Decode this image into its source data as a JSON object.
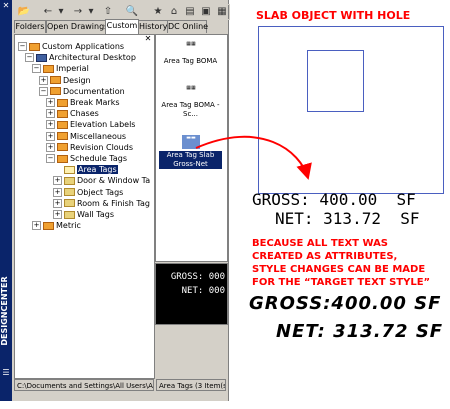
{
  "palette": {
    "title": "DESIGNCENTER",
    "close_glyph": "✕",
    "properties_glyph": "☰"
  },
  "tabs": [
    {
      "label": "Folders"
    },
    {
      "label": "Open Drawings"
    },
    {
      "label": "Custom"
    },
    {
      "label": "History"
    },
    {
      "label": "DC Online"
    }
  ],
  "tree": [
    {
      "label": "Custom Applications",
      "level": 0,
      "expander": "−",
      "icon": "orange"
    },
    {
      "label": "Architectural Desktop",
      "level": 1,
      "expander": "−",
      "icon": "blue"
    },
    {
      "label": "Imperial",
      "level": 2,
      "expander": "−",
      "icon": "orange"
    },
    {
      "label": "Design",
      "level": 3,
      "expander": "+",
      "icon": "orange"
    },
    {
      "label": "Documentation",
      "level": 3,
      "expander": "−",
      "icon": "orange"
    },
    {
      "label": "Break Marks",
      "level": 4,
      "expander": "+",
      "icon": "orange"
    },
    {
      "label": "Chases",
      "level": 4,
      "expander": "+",
      "icon": "orange"
    },
    {
      "label": "Elevation Labels",
      "level": 4,
      "expander": "+",
      "icon": "orange"
    },
    {
      "label": "Miscellaneous",
      "level": 4,
      "expander": "+",
      "icon": "orange"
    },
    {
      "label": "Revision Clouds",
      "level": 4,
      "expander": "+",
      "icon": "orange"
    },
    {
      "label": "Schedule Tags",
      "level": 4,
      "expander": "−",
      "icon": "orange"
    },
    {
      "label": "Area Tags",
      "level": 5,
      "expander": "",
      "icon": "open",
      "selected": true
    },
    {
      "label": "Door & Window Ta",
      "level": 5,
      "expander": "+",
      "icon": "folder"
    },
    {
      "label": "Object Tags",
      "level": 5,
      "expander": "+",
      "icon": "folder"
    },
    {
      "label": "Room & Finish Tag",
      "level": 5,
      "expander": "+",
      "icon": "folder"
    },
    {
      "label": "Wall Tags",
      "level": 5,
      "expander": "+",
      "icon": "folder"
    },
    {
      "label": "Metric",
      "level": 2,
      "expander": "+",
      "icon": "orange"
    }
  ],
  "content_items": [
    {
      "label": "Area Tag BOMA",
      "thumb": "▦▦"
    },
    {
      "label": "Area Tag BOMA - Sc...",
      "thumb": "▦▦"
    },
    {
      "label": "Area Tag Slab Gross-Net",
      "thumb": "▬▬",
      "selected": true
    }
  ],
  "preview": {
    "gross": "GROSS: 000",
    "net": "NET: 000"
  },
  "status": {
    "path": "C:\\Documents and Settings\\All Users\\Appli...",
    "count": "Area Tags (3 Item(s))"
  },
  "annotation": {
    "slab_title": "SLAB OBJECT WITH HOLE",
    "gross_line": "GROSS: 400.00  SF",
    "net_line": "NET: 313.72  SF",
    "note_lines": [
      "BECAUSE ALL TEXT WAS",
      "CREATED AS ATTRIBUTES,",
      "STYLE CHANGES CAN BE MADE",
      "FOR THE “TARGET TEXT STYLE”"
    ],
    "script_gross": "GROSS:400.00 SF",
    "script_net": "NET: 313.72 SF",
    "accent_color": "#ff0000",
    "slab_line_color": "#4a5fc0"
  }
}
